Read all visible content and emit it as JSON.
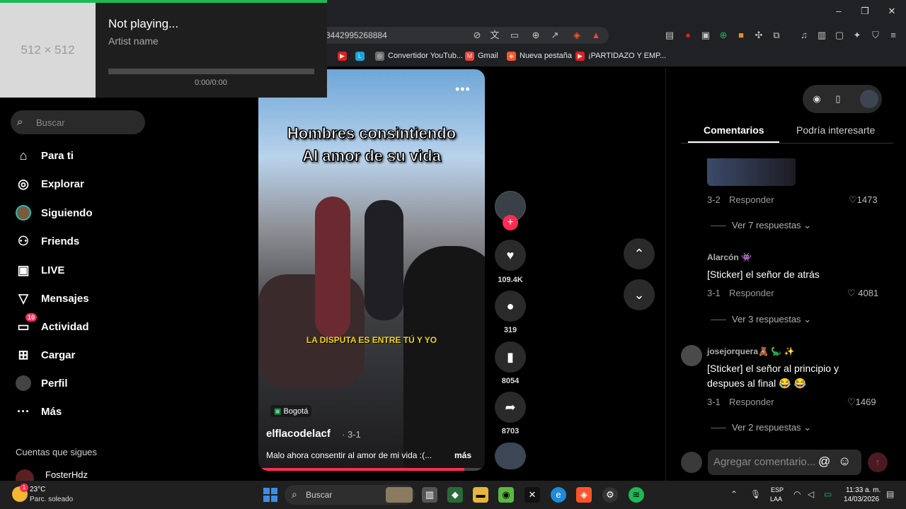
{
  "browser": {
    "url_fragment": "3442995268884",
    "window_controls": {
      "minimize": "–",
      "maximize": "❐",
      "close": "✕"
    },
    "bookmarks": [
      {
        "label": "",
        "color": "#e02020"
      },
      {
        "label": "L",
        "color": "#1ba3d7"
      },
      {
        "label": "Convertidor YouTub...",
        "color": "#6f6f6f"
      },
      {
        "label": "Gmail",
        "color": "#e8453c"
      },
      {
        "label": "Nueva pestaña",
        "color": "#fb542b"
      },
      {
        "label": "¡PARTIDAZO Y EMP...",
        "color": "#e02020"
      }
    ]
  },
  "overlay": {
    "art_placeholder": "512 × 512",
    "title": "Not playing...",
    "artist": "Artist name",
    "time": "0:00/0:00",
    "progress": 0.0,
    "accent": "#1db954"
  },
  "sidebar": {
    "search_placeholder": "Buscar",
    "nav": [
      {
        "label": "Para ti",
        "icon": "home-icon"
      },
      {
        "label": "Explorar",
        "icon": "compass-icon"
      },
      {
        "label": "Siguiendo",
        "icon": "avatar-icon"
      },
      {
        "label": "Friends",
        "icon": "friends-icon"
      },
      {
        "label": "LIVE",
        "icon": "live-tv-icon"
      },
      {
        "label": "Mensajes",
        "icon": "send-icon"
      },
      {
        "label": "Actividad",
        "icon": "activity-icon",
        "badge": "10"
      },
      {
        "label": "Cargar",
        "icon": "upload-icon"
      },
      {
        "label": "Perfil",
        "icon": "profile-avatar-icon"
      },
      {
        "label": "Más",
        "icon": "more-dots-icon"
      }
    ],
    "following_title": "Cuentas que sigues",
    "following": [
      "FosterHdz"
    ]
  },
  "video": {
    "caption_line1": "Hombres consintiendo",
    "caption_line2": "Al amor de su vida",
    "subtitle": "LA DISPUTA ES ENTRE TÚ Y YO",
    "more": "•••",
    "location": "Bogotá",
    "author": "elflacodelacf",
    "date": "· 3-1",
    "description": "Malo ahora consentir al amor de mi vida :(...",
    "description_more": "más",
    "progress": 0.91
  },
  "actions": {
    "likes": "109.4K",
    "comments": "319",
    "saves": "8054",
    "shares": "8703",
    "follow_plus": "+"
  },
  "panel": {
    "tab_comments": "Comentarios",
    "tab_related": "Podría interesarte",
    "comments": [
      {
        "user": "",
        "text": "",
        "date": "3-2",
        "reply": "Responder",
        "likes": "1473",
        "more": "Ver 7 respuestas"
      },
      {
        "user": "Alarcón 👾",
        "text": "[Sticker] el señor de atrás",
        "date": "3-1",
        "reply": "Responder",
        "likes": "4081",
        "more": "Ver 3 respuestas"
      },
      {
        "user": "josejorquera🧸 🦕 ✨",
        "text_line1": "[Sticker] el señor al principio y",
        "text_line2": "despues al final 😂 😂",
        "date": "3-1",
        "reply": "Responder",
        "likes": "1469",
        "more": "Ver 2 respuestas"
      }
    ],
    "input_placeholder": "Agregar comentario...",
    "input_at": "@",
    "input_emoji": "☺"
  },
  "taskbar": {
    "temp": "23°C",
    "condition": "Parc. soleado",
    "weather_badge": "1",
    "search": "Buscar",
    "lang1": "ESP",
    "lang2": "LAA",
    "time": "11:33 a. m.",
    "date": "14/03/2026"
  }
}
